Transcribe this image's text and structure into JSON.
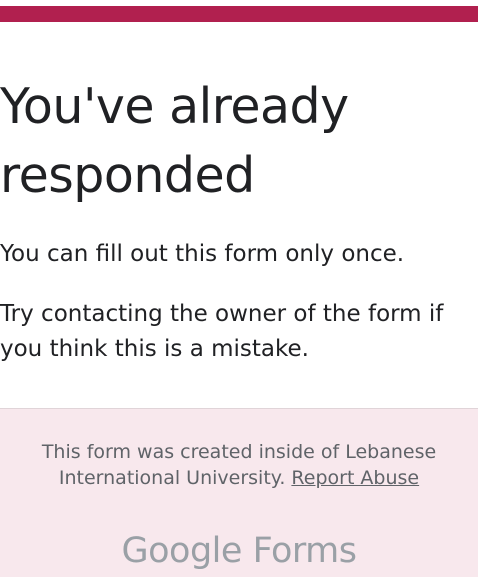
{
  "header": {
    "accent_color": "#b1204f"
  },
  "main": {
    "title_line1": "You've already",
    "title_line2": "responded",
    "message1": "You can fill out this form only once.",
    "message2": "Try contacting the owner of the form if you think this is a mistake."
  },
  "footer": {
    "created_text": "This form was created inside of Lebanese International University.",
    "report_abuse_label": "Report Abuse",
    "brand_google": "Google",
    "brand_forms": "Forms",
    "background_color": "#f8e8ed"
  }
}
